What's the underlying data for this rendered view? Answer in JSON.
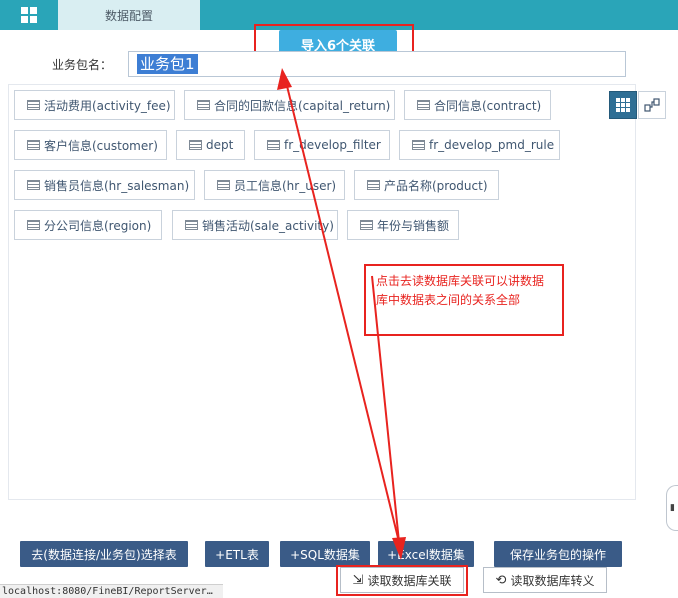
{
  "topbar": {
    "tab_label": "数据配置",
    "menu_icon": "grid-menu-icon",
    "color": "#2aa5b8"
  },
  "import_button": {
    "label": "导入6个关联"
  },
  "package": {
    "label": "业务包名：",
    "value": "业务包1"
  },
  "tables": [
    {
      "label": "活动费用(activity_fee)"
    },
    {
      "label": "合同的回款信息(capital_return)"
    },
    {
      "label": "合同信息(contract)"
    },
    {
      "label": "客户信息(customer)"
    },
    {
      "label": "dept"
    },
    {
      "label": "fr_develop_filter"
    },
    {
      "label": "fr_develop_pmd_rule"
    },
    {
      "label": "销售员信息(hr_salesman)"
    },
    {
      "label": "员工信息(hr_user)"
    },
    {
      "label": "产品名称(product)"
    },
    {
      "label": "分公司信息(region)"
    },
    {
      "label": "销售活动(sale_activity)"
    },
    {
      "label": "年份与销售额"
    }
  ],
  "annotation": {
    "text": "点击去读数据库关联可以讲数据库中数据表之间的关系全部"
  },
  "bottom_buttons": {
    "select_table": "去(数据连接/业务包)选择表",
    "etl": "+ETL表",
    "sql": "+SQL数据集",
    "excel": "+Excel数据集",
    "save": "保存业务包的操作"
  },
  "secondary_buttons": {
    "read_relations": "读取数据库关联",
    "read_translation": "读取数据库转义"
  },
  "status_bar": {
    "url": "localhost:8080/FineBI/ReportServer…"
  },
  "colors": {
    "accent": "#3eaee0",
    "primary_dark": "#3a5b87",
    "highlight_red": "#e8231f"
  }
}
